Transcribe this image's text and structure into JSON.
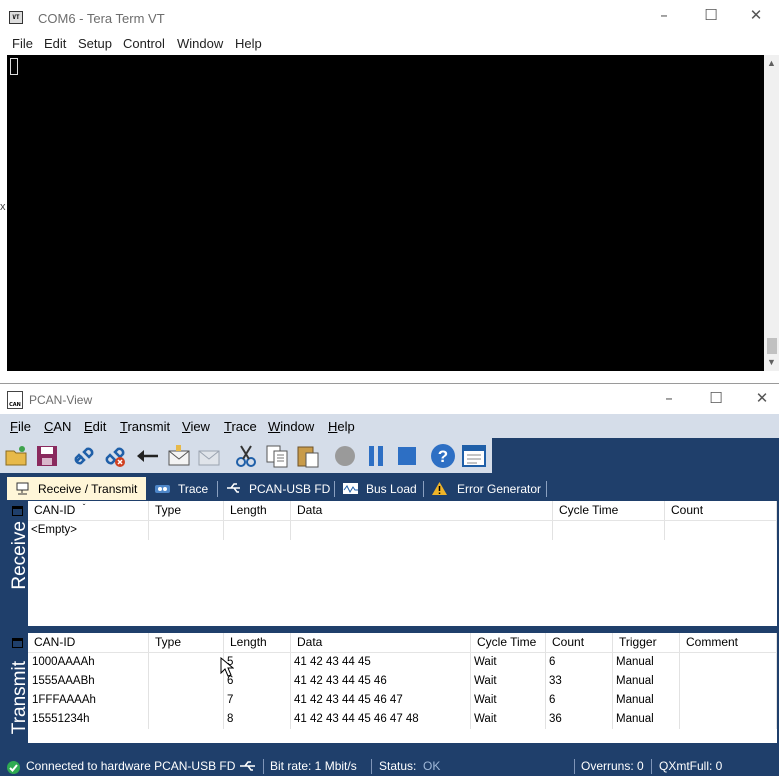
{
  "teraterm": {
    "title": "COM6 - Tera Term VT",
    "icon": "VT",
    "menu": [
      "File",
      "Edit",
      "Setup",
      "Control",
      "Window",
      "Help"
    ],
    "left_fragment": "x"
  },
  "pcan": {
    "title": "PCAN-View",
    "icon_text": "CAN",
    "menu": [
      "File",
      "CAN",
      "Edit",
      "Transmit",
      "View",
      "Trace",
      "Window",
      "Help"
    ],
    "menu_mnemonics": [
      "F",
      "C",
      "E",
      "T",
      "V",
      "T",
      "W",
      "H"
    ],
    "toolbar_icons": [
      "open-folder-icon",
      "save-icon",
      "connect-icon",
      "disconnect-icon",
      "reset-icon",
      "new-message-icon",
      "new-message-disabled-icon",
      "cut-icon",
      "copy-icon",
      "paste-icon",
      "record-icon",
      "pause-icon",
      "stop-icon",
      "help-icon",
      "window-icon"
    ],
    "tabs": [
      {
        "label": "Receive / Transmit",
        "icon": "receive-transmit-icon",
        "active": true
      },
      {
        "label": "Trace",
        "icon": "trace-icon",
        "active": false
      },
      {
        "label": "PCAN-USB FD",
        "icon": "usb-icon",
        "active": false
      },
      {
        "label": "Bus Load",
        "icon": "bus-load-icon",
        "active": false
      },
      {
        "label": "Error Generator",
        "icon": "warning-icon",
        "active": false
      }
    ],
    "receive": {
      "side_label": "Receive",
      "columns": [
        "CAN-ID",
        "Type",
        "Length",
        "Data",
        "Cycle Time",
        "Count"
      ],
      "empty_text": "<Empty>"
    },
    "transmit": {
      "side_label": "Transmit",
      "columns": [
        "CAN-ID",
        "Type",
        "Length",
        "Data",
        "Cycle Time",
        "Count",
        "Trigger",
        "Comment"
      ],
      "rows": [
        {
          "id": "1000AAAAh",
          "type": "",
          "length": "5",
          "data": "41 42 43 44 45",
          "cycle": "Wait",
          "count": "6",
          "trigger": "Manual",
          "comment": ""
        },
        {
          "id": "1555AAABh",
          "type": "",
          "length": "6",
          "data": "41 42 43 44 45 46",
          "cycle": "Wait",
          "count": "33",
          "trigger": "Manual",
          "comment": ""
        },
        {
          "id": "1FFFAAAAh",
          "type": "",
          "length": "7",
          "data": "41 42 43 44 45 46 47",
          "cycle": "Wait",
          "count": "6",
          "trigger": "Manual",
          "comment": ""
        },
        {
          "id": "15551234h",
          "type": "",
          "length": "8",
          "data": "41 42 43 44 45 46 47 48",
          "cycle": "Wait",
          "count": "36",
          "trigger": "Manual",
          "comment": ""
        }
      ]
    },
    "status": {
      "connected": "Connected to hardware PCAN-USB FD",
      "bitrate": "Bit rate: 1 Mbit/s",
      "status_label": "Status:",
      "status_value": "OK",
      "overruns": "Overruns: 0",
      "qxmtfull": "QXmtFull: 0"
    },
    "colors": {
      "accent": "#1f3f6b",
      "menu_bg": "#d5dde9",
      "active_tab": "#fff6d8",
      "ok_green": "#2faa52"
    }
  }
}
